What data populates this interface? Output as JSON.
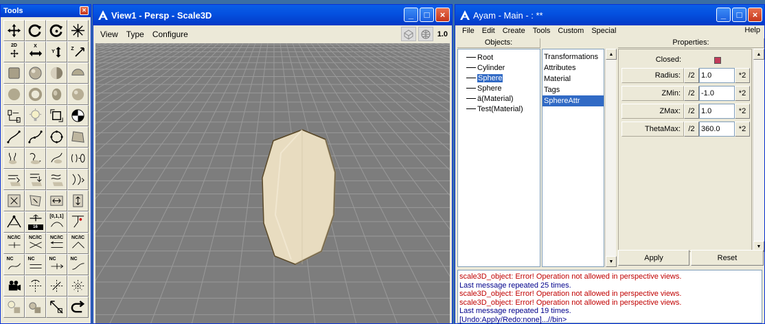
{
  "tools_window": {
    "title": "Tools",
    "tool_texts": {
      "two_d": "2D",
      "x": "X",
      "y": "Y",
      "z": "Z",
      "knots": "[0,1,1]",
      "num": "16",
      "nc_ic": "NC/IC",
      "nc": "NC"
    }
  },
  "view_window": {
    "title": "View1 - Persp - Scale3D",
    "menu": [
      "View",
      "Type",
      "Configure"
    ],
    "zoom_label": "1.0"
  },
  "main_window": {
    "title": "Ayam - Main - : **",
    "menu": [
      "File",
      "Edit",
      "Create",
      "Tools",
      "Custom",
      "Special"
    ],
    "help": "Help",
    "objects_header": "Objects:",
    "objects": [
      "Root",
      "Cylinder",
      "Sphere",
      "Sphere",
      "ä(Material)",
      "Test(Material)"
    ],
    "selected_object_index": 2,
    "props_list": [
      "Transformations",
      "Attributes",
      "Material",
      "Tags",
      "SphereAttr"
    ],
    "selected_prop_index": 4,
    "properties_header": "Properties:",
    "closed_label": "Closed:",
    "properties": [
      {
        "label": "Radius:",
        "half": "/2",
        "value": "1.0",
        "double": "*2"
      },
      {
        "label": "ZMin:",
        "half": "/2",
        "value": "-1.0",
        "double": "*2"
      },
      {
        "label": "ZMax:",
        "half": "/2",
        "value": "1.0",
        "double": "*2"
      },
      {
        "label": "ThetaMax:",
        "half": "/2",
        "value": "360.0",
        "double": "*2"
      }
    ],
    "apply_label": "Apply",
    "reset_label": "Reset",
    "console": [
      {
        "type": "err",
        "text": "scale3D_object: Error! Operation not allowed in perspective views."
      },
      {
        "type": "info",
        "text": "Last message repeated 25 times."
      },
      {
        "type": "err",
        "text": "scale3D_object: Error! Operation not allowed in perspective views."
      },
      {
        "type": "err",
        "text": "scale3D_object: Error! Operation not allowed in perspective views."
      },
      {
        "type": "info",
        "text": "Last message repeated 19 times."
      },
      {
        "type": "info",
        "text": "[Undo:Apply/Redo:none]...//bin>"
      }
    ]
  },
  "colors": {
    "closed_swatch": "#c23b5a",
    "viewport_bg": "#7d7d7d",
    "object_fill": "#e8dcc0",
    "error_text": "#c00000",
    "info_text": "#00008b"
  }
}
